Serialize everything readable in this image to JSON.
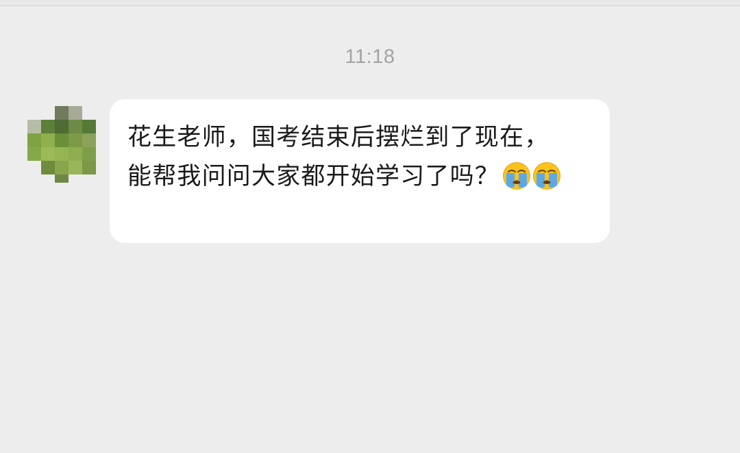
{
  "chat": {
    "timestamp": "11:18",
    "messages": [
      {
        "sender": "contact",
        "avatar_style": "pixelated-green",
        "text": "花生老师，国考结束后摆烂到了现在，能帮我问问大家都开始学习了吗？",
        "emojis": [
          "loudly-crying-face-icon",
          "loudly-crying-face-icon"
        ]
      }
    ]
  },
  "colors": {
    "background": "#ededed",
    "bubble": "#ffffff",
    "timestamp": "#a3a3a3",
    "text": "#1a1a1a",
    "emoji_face": "#fcc21b",
    "emoji_tears": "#5aa9e6"
  }
}
